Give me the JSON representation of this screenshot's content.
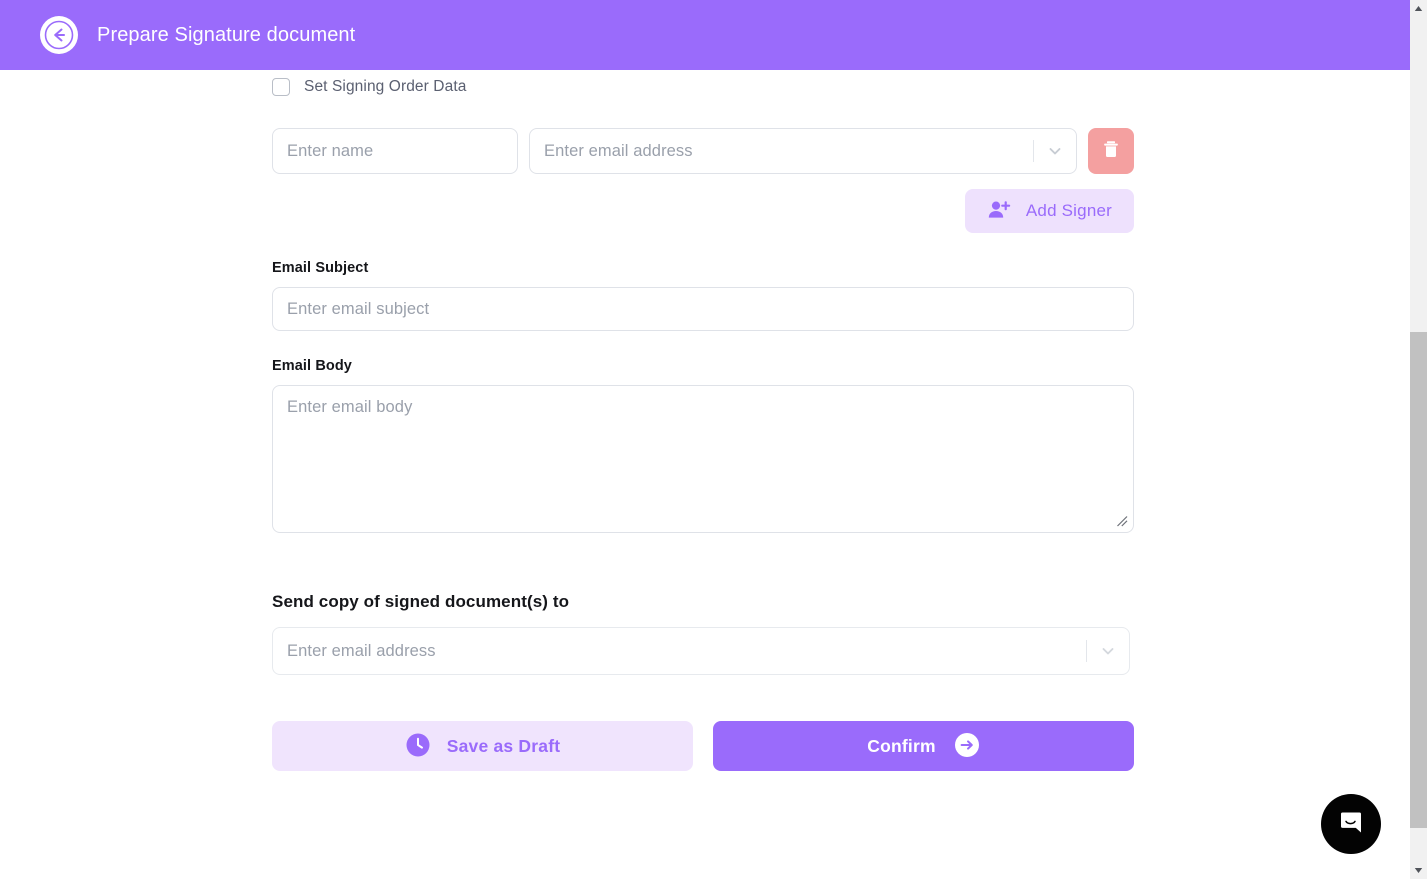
{
  "header": {
    "title": "Prepare Signature document",
    "back_icon": "arrow-left-icon",
    "background_color": "#9a6bfb"
  },
  "form": {
    "signing_order": {
      "label": "Set Signing Order Data",
      "checked": false
    },
    "signer": {
      "name_placeholder": "Enter name",
      "name_value": "",
      "email_placeholder": "Enter email address",
      "email_value": "",
      "dropdown_icon": "chevron-down-icon",
      "delete_icon": "trash-icon",
      "delete_color": "#f4a0a0"
    },
    "add_signer": {
      "label": "Add Signer",
      "icon": "user-plus-icon",
      "background_color": "#eee1fd",
      "text_color": "#9a6bfb"
    },
    "email_subject": {
      "label": "Email Subject",
      "placeholder": "Enter email subject",
      "value": ""
    },
    "email_body": {
      "label": "Email Body",
      "placeholder": "Enter email body",
      "value": "",
      "resize_icon": "resize-handle-icon"
    },
    "send_copy": {
      "title": "Send copy of signed document(s) to",
      "placeholder": "Enter email address",
      "value": "",
      "dropdown_icon": "chevron-down-icon"
    }
  },
  "actions": {
    "save_draft": {
      "label": "Save as Draft",
      "icon": "clock-icon",
      "background_color": "#f0e4fd",
      "text_color": "#9a6bfb"
    },
    "confirm": {
      "label": "Confirm",
      "icon": "arrow-right-circle-icon",
      "background_color": "#9a6bfb",
      "text_color": "#ffffff"
    }
  },
  "chat": {
    "icon": "chat-bubble-icon",
    "background_color": "#030303"
  },
  "scrollbar": {
    "up_icon": "scroll-up-arrow-icon",
    "down_icon": "scroll-down-arrow-icon"
  }
}
